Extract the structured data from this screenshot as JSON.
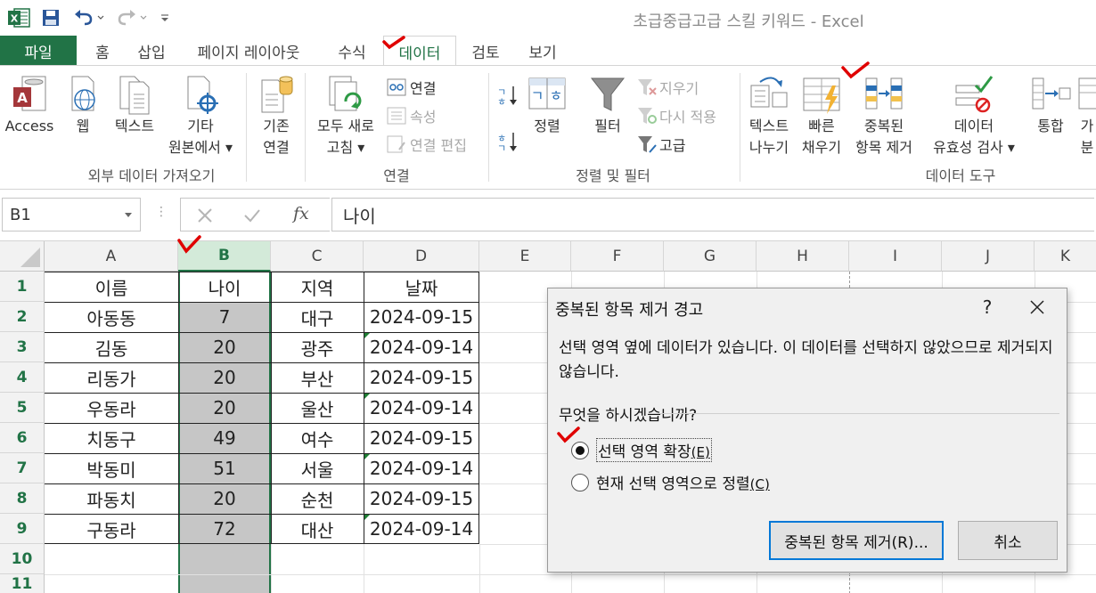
{
  "window": {
    "title": "초급중급고급 스킬 키워드 - Excel"
  },
  "tabs": [
    "파일",
    "홈",
    "삽입",
    "페이지 레이아웃",
    "수식",
    "데이터",
    "검토",
    "보기"
  ],
  "active_tab": "데이터",
  "ribbon": {
    "external": {
      "label": "외부 데이터 가져오기",
      "access": "Access",
      "web": "웹",
      "text": "텍스트",
      "other_l1": "기타",
      "other_l2": "원본에서 ▾",
      "existing_l1": "기존",
      "existing_l2": "연결"
    },
    "connections": {
      "label": "연결",
      "refresh_l1": "모두 새로",
      "refresh_l2": "고침 ▾",
      "connections": "연결",
      "properties": "속성",
      "edit_links": "연결 편집"
    },
    "sort_filter": {
      "label": "정렬 및 필터",
      "sort": "정렬",
      "filter": "필터",
      "clear": "지우기",
      "reapply": "다시 적용",
      "advanced": "고급"
    },
    "data_tools": {
      "label": "데이터 도구",
      "text_to_cols_l1": "텍스트",
      "text_to_cols_l2": "나누기",
      "flash_fill_l1": "빠른",
      "flash_fill_l2": "채우기",
      "remove_dup_l1": "중복된",
      "remove_dup_l2": "항목 제거",
      "validation_l1": "데이터",
      "validation_l2": "유효성 검사 ▾",
      "consolidate": "통합",
      "partial_l1": "가",
      "partial_l2": "분"
    }
  },
  "formula_bar": {
    "name_box": "B1",
    "fx": "fx",
    "content": "나이"
  },
  "grid": {
    "columns": [
      "A",
      "B",
      "C",
      "D",
      "E",
      "F",
      "G",
      "H",
      "I",
      "J",
      "K"
    ],
    "rows": [
      "1",
      "2",
      "3",
      "4",
      "5",
      "6",
      "7",
      "8",
      "9",
      "10",
      "11"
    ],
    "header": {
      "name": "이름",
      "age": "나이",
      "region": "지역",
      "date": "날짜"
    },
    "data": [
      {
        "name": "아동동",
        "age": "7",
        "region": "대구",
        "date": "2024-09-15"
      },
      {
        "name": "김동",
        "age": "20",
        "region": "광주",
        "date": "2024-09-14"
      },
      {
        "name": "리동가",
        "age": "20",
        "region": "부산",
        "date": "2024-09-15"
      },
      {
        "name": "우동라",
        "age": "20",
        "region": "울산",
        "date": "2024-09-14"
      },
      {
        "name": "치동구",
        "age": "49",
        "region": "여수",
        "date": "2024-09-15"
      },
      {
        "name": "박동미",
        "age": "51",
        "region": "서울",
        "date": "2024-09-14"
      },
      {
        "name": "파동치",
        "age": "20",
        "region": "순천",
        "date": "2024-09-15"
      },
      {
        "name": "구동라",
        "age": "72",
        "region": "대산",
        "date": "2024-09-14"
      }
    ]
  },
  "dialog": {
    "title": "중복된 항목 제거 경고",
    "help": "?",
    "message": "선택 영역 옆에 데이터가 있습니다. 이 데이터를 선택하지 않았으므로 제거되지 않습니다.",
    "question": "무엇을 하시겠습니까?",
    "option_expand": "선택 영역 확장",
    "option_expand_key": "(E)",
    "option_current": "현재 선택 영역으로 정렬",
    "option_current_key": "(C)",
    "btn_remove": "중복된 항목 제거(R)...",
    "btn_cancel": "취소"
  },
  "colors": {
    "excel_green": "#217346",
    "selection": "#c6c6c6",
    "annotation": "#e00000"
  }
}
